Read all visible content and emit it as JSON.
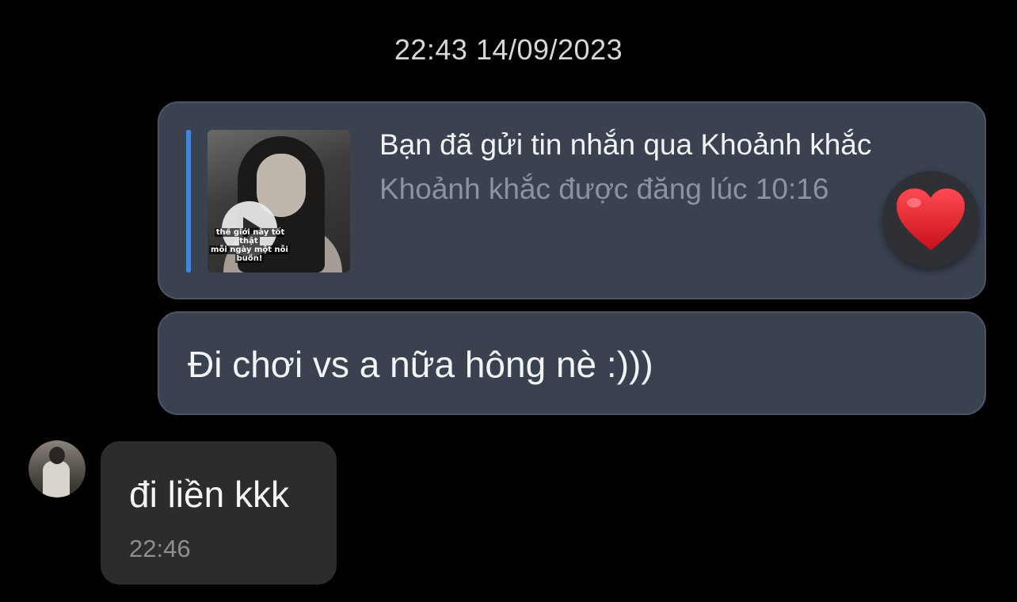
{
  "conversation": {
    "date_header": "22:43 14/09/2023"
  },
  "moment_reply": {
    "title": "Bạn đã gửi tin nhắn qua Khoảnh khắc",
    "subtitle": "Khoảnh khắc được đăng lúc 10:16",
    "thumbnail_caption_line1": "thế giới này tốt thật",
    "thumbnail_caption_line2": "mỗi ngày một nỗi",
    "thumbnail_caption_line3": "buồn!",
    "play_icon": "play-icon",
    "reaction_icon": "heart-icon",
    "accent_color": "#3d86e8"
  },
  "outgoing_message": {
    "text": "Đi chơi vs a nữa hông nè :)))"
  },
  "incoming_message": {
    "text": "đi liền kkk",
    "time": "22:46"
  },
  "colors": {
    "background": "#000000",
    "outgoing_bubble": "#3a4250",
    "incoming_bubble": "#2c2c2e",
    "reaction": "#e8272e"
  }
}
